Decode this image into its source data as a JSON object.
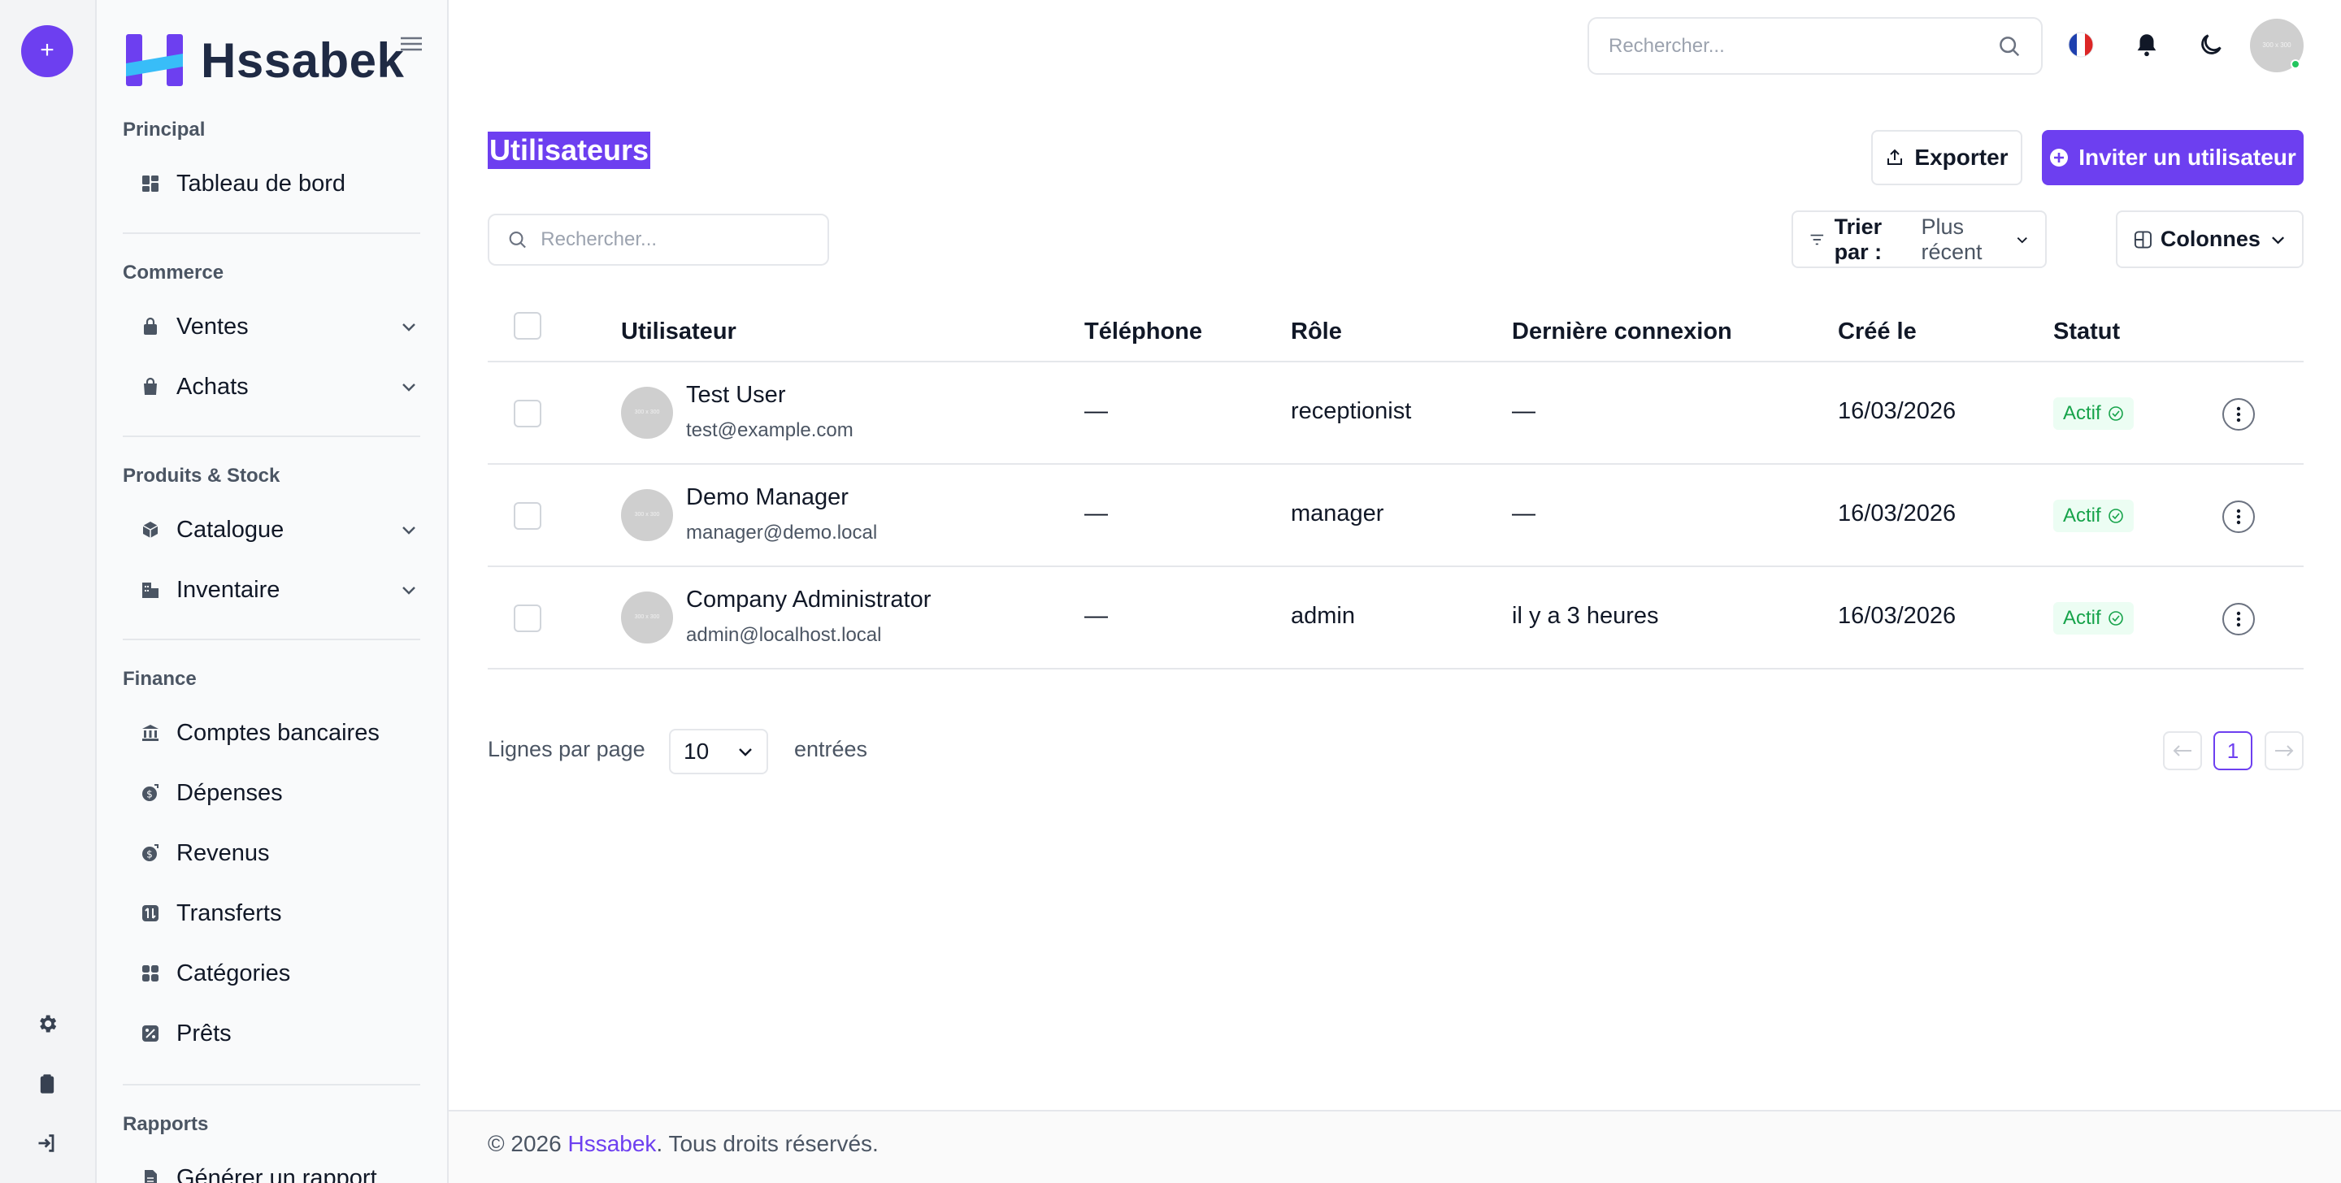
{
  "rail": {
    "add_label": "+"
  },
  "sidebar": {
    "brand": "Hssabek",
    "sections": [
      {
        "title": "Principal",
        "items": [
          {
            "label": "Tableau de bord",
            "icon": "dashboard-icon"
          }
        ]
      },
      {
        "title": "Commerce",
        "items": [
          {
            "label": "Ventes",
            "icon": "lock-bag-icon"
          },
          {
            "label": "Achats",
            "icon": "shopping-bag-icon"
          }
        ]
      },
      {
        "title": "Produits & Stock",
        "items": [
          {
            "label": "Catalogue",
            "icon": "box-icon"
          },
          {
            "label": "Inventaire",
            "icon": "warehouse-icon"
          }
        ]
      },
      {
        "title": "Finance",
        "items": [
          {
            "label": "Comptes bancaires",
            "icon": "bank-icon"
          },
          {
            "label": "Dépenses",
            "icon": "expense-icon"
          },
          {
            "label": "Revenus",
            "icon": "income-icon"
          },
          {
            "label": "Transferts",
            "icon": "transfer-icon"
          },
          {
            "label": "Catégories",
            "icon": "categories-icon"
          },
          {
            "label": "Prêts",
            "icon": "loan-icon"
          }
        ]
      },
      {
        "title": "Rapports",
        "items": [
          {
            "label": "Générer un rapport",
            "icon": "report-icon"
          }
        ]
      }
    ]
  },
  "header": {
    "search_placeholder": "Rechercher...",
    "avatar_text": "300 x 300"
  },
  "main": {
    "title": "Utilisateurs",
    "export_label": "Exporter",
    "invite_label": "Inviter un utilisateur",
    "search_placeholder": "Rechercher...",
    "sort_label": "Trier par :",
    "sort_value": "Plus récent",
    "columns_label": "Colonnes"
  },
  "table": {
    "headers": [
      "Utilisateur",
      "Téléphone",
      "Rôle",
      "Dernière connexion",
      "Créé le",
      "Statut"
    ],
    "rows": [
      {
        "name": "Test User",
        "email": "test@example.com",
        "phone": "—",
        "role": "receptionist",
        "last_login": "—",
        "created": "16/03/2026",
        "status": "Actif",
        "avatar_text": "300 x 300"
      },
      {
        "name": "Demo Manager",
        "email": "manager@demo.local",
        "phone": "—",
        "role": "manager",
        "last_login": "—",
        "created": "16/03/2026",
        "status": "Actif",
        "avatar_text": "300 x 300"
      },
      {
        "name": "Company Administrator",
        "email": "admin@localhost.local",
        "phone": "—",
        "role": "admin",
        "last_login": "il y a 3 heures",
        "created": "16/03/2026",
        "status": "Actif",
        "avatar_text": "300 x 300"
      }
    ]
  },
  "pagination": {
    "rows_label": "Lignes par page",
    "rows_value": "10",
    "entries_label": "entrées",
    "current_page": "1"
  },
  "footer": {
    "prefix": "© 2026 ",
    "brand": "Hssabek",
    "suffix": ". Tous droits réservés."
  },
  "colors": {
    "accent": "#6d3ff0",
    "success": "#16a34a"
  }
}
